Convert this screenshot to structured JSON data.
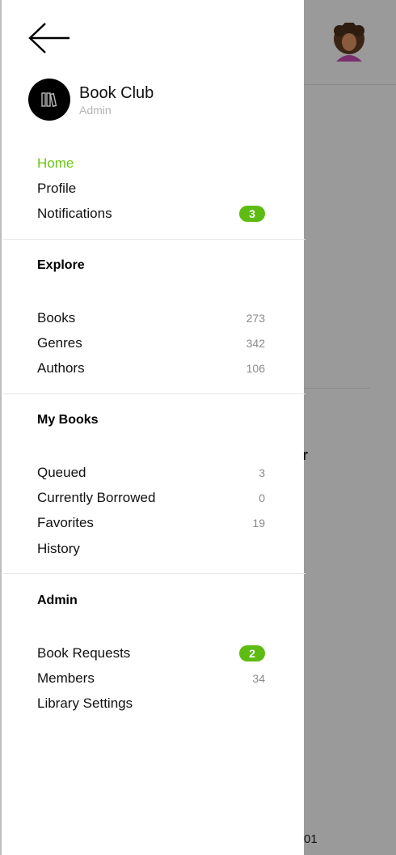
{
  "colors": {
    "accent": "#6cc417",
    "badge": "#5dbb12",
    "overlay": "#9a9a9a"
  },
  "background": {
    "fragment_text": "r",
    "number_fragment": "01"
  },
  "drawer": {
    "back_icon": "arrow-left-icon",
    "app": {
      "name": "Book Club",
      "role": "Admin",
      "logo_icon": "books-icon"
    },
    "main_items": [
      {
        "label": "Home",
        "active": true
      },
      {
        "label": "Profile"
      },
      {
        "label": "Notifications",
        "badge": "3"
      }
    ],
    "sections": [
      {
        "title": "Explore",
        "items": [
          {
            "label": "Books",
            "count": "273"
          },
          {
            "label": "Genres",
            "count": "342"
          },
          {
            "label": "Authors",
            "count": "106"
          }
        ]
      },
      {
        "title": "My Books",
        "items": [
          {
            "label": "Queued",
            "count": "3"
          },
          {
            "label": "Currently Borrowed",
            "count": "0"
          },
          {
            "label": "Favorites",
            "count": "19"
          },
          {
            "label": "History",
            "count": ""
          }
        ]
      },
      {
        "title": "Admin",
        "items": [
          {
            "label": "Book Requests",
            "badge": "2"
          },
          {
            "label": "Members",
            "count": "34"
          },
          {
            "label": "Library Settings",
            "count": ""
          }
        ]
      }
    ]
  }
}
